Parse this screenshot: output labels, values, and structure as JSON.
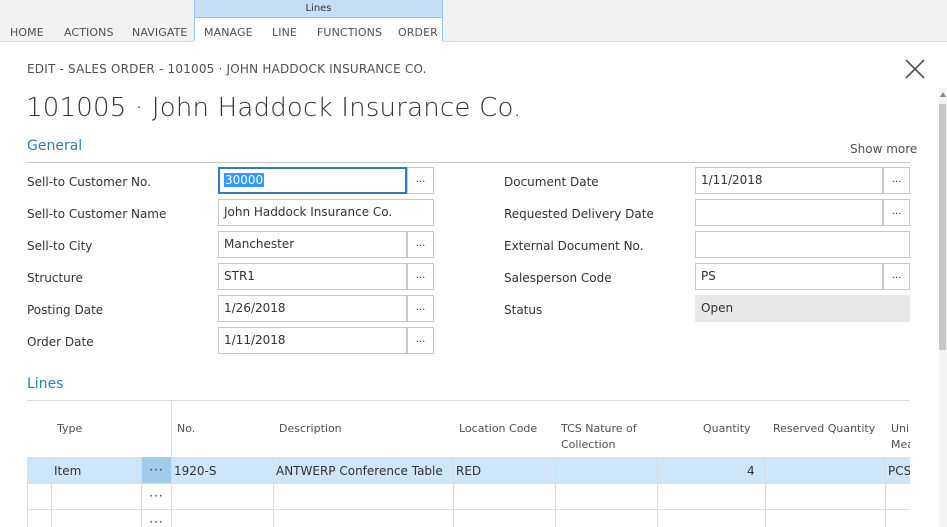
{
  "ribbon": {
    "tabs": [
      "HOME",
      "ACTIONS",
      "NAVIGATE"
    ],
    "group_title": "Lines",
    "group_tabs": [
      "MANAGE",
      "LINE",
      "FUNCTIONS",
      "ORDER"
    ]
  },
  "header": {
    "breadcrumb": "EDIT - SALES ORDER - 101005 · JOHN HADDOCK INSURANCE CO.",
    "title": "101005 · John Haddock Insurance Co.",
    "close_icon": "close-icon"
  },
  "general": {
    "section_title": "General",
    "show_more": "Show more",
    "left_fields": [
      {
        "label": "Sell-to Customer No.",
        "value": "30000"
      },
      {
        "label": "Sell-to Customer Name",
        "value": "John Haddock Insurance Co."
      },
      {
        "label": "Sell-to City",
        "value": "Manchester"
      },
      {
        "label": "Structure",
        "value": "STR1"
      },
      {
        "label": "Posting Date",
        "value": "1/26/2018"
      },
      {
        "label": "Order Date",
        "value": "1/11/2018"
      }
    ],
    "right_fields": [
      {
        "label": "Document Date",
        "value": "1/11/2018"
      },
      {
        "label": "Requested Delivery Date",
        "value": ""
      },
      {
        "label": "External Document No.",
        "value": ""
      },
      {
        "label": "Salesperson Code",
        "value": "PS"
      },
      {
        "label": "Status",
        "value": "Open"
      }
    ],
    "lookup_label": "..."
  },
  "lines": {
    "section_title": "Lines",
    "columns": {
      "type": "Type",
      "no": "No.",
      "description": "Description",
      "location": "Location Code",
      "tcs1": "TCS Nature of",
      "tcs2": "Collection",
      "quantity": "Quantity",
      "reserved": "Reserved Quantity",
      "unit1": "Uni",
      "unit2": "Mea"
    },
    "row": {
      "type": "Item",
      "menu": "···",
      "no": "1920-S",
      "description": "ANTWERP Conference Table",
      "location": "RED",
      "quantity": "4",
      "unit": "PCS"
    },
    "empty_menu": "···"
  }
}
